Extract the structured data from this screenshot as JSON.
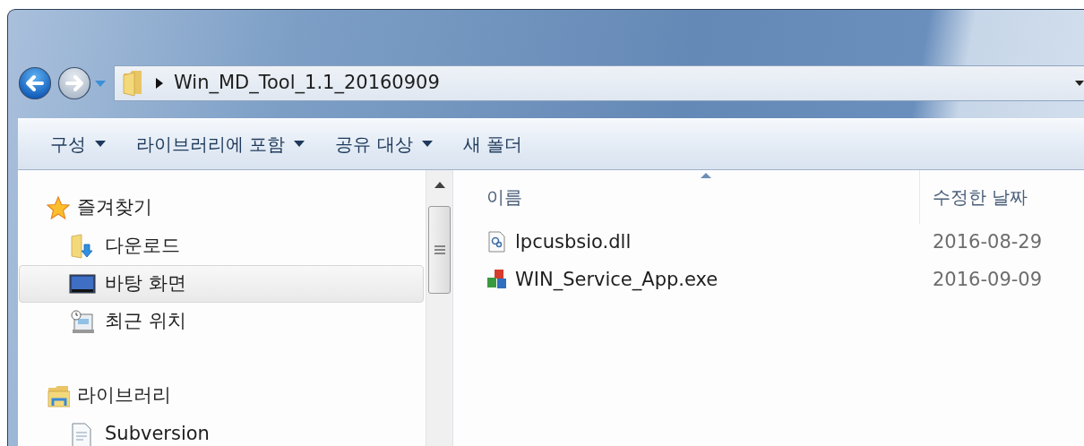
{
  "nav": {
    "back_enabled": true,
    "forward_enabled": false
  },
  "address": {
    "path": [
      "Win_MD_Tool_1.1_20160909"
    ]
  },
  "toolbar": [
    {
      "label": "구성",
      "dropdown": true
    },
    {
      "label": "라이브러리에 포함",
      "dropdown": true
    },
    {
      "label": "공유 대상",
      "dropdown": true
    },
    {
      "label": "새 폴더",
      "dropdown": false
    }
  ],
  "sidebar": {
    "groups": [
      {
        "label": "즐겨찾기",
        "kind": "star",
        "children": [
          {
            "label": "다운로드",
            "kind": "download",
            "selected": false
          },
          {
            "label": "바탕 화면",
            "kind": "desktop",
            "selected": true
          },
          {
            "label": "최근 위치",
            "kind": "recent",
            "selected": false
          }
        ]
      },
      {
        "label": "라이브러리",
        "kind": "library",
        "children": [
          {
            "label": "Subversion",
            "kind": "document",
            "selected": false
          }
        ]
      }
    ]
  },
  "file_list": {
    "columns": [
      {
        "label": "이름",
        "sorted": true
      },
      {
        "label": "수정한 날짜",
        "sorted": false
      }
    ],
    "rows": [
      {
        "name": "lpcusbsio.dll",
        "kind": "dll",
        "modified": "2016-08-29"
      },
      {
        "name": "WIN_Service_App.exe",
        "kind": "exe",
        "modified": "2016-09-09"
      }
    ]
  }
}
